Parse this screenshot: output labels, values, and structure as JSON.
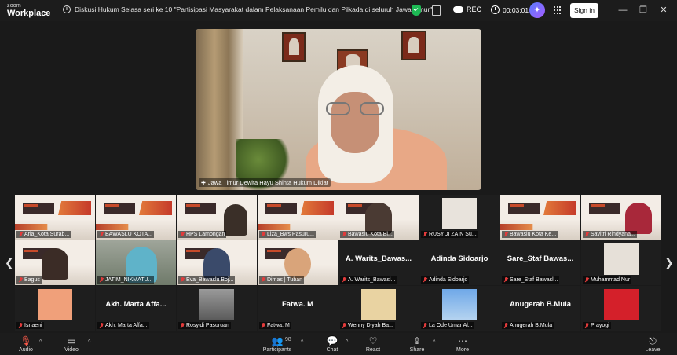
{
  "app": {
    "brand_small": "zoom",
    "brand_big": "Workplace"
  },
  "meeting": {
    "title": "Diskusi Hukum Selasa seri ke 10 \"Partisipasi Masyarakat dalam Pelaksanaan Pemilu dan Pilkada di seluruh Jawa Timur\"",
    "rec_label": "REC",
    "timer": "00:03:01",
    "signin_label": "Sign in"
  },
  "speaker": {
    "label": "Jawa Timur Dewita Hayu Shinta Hukum Diklat"
  },
  "gallery": {
    "row1": [
      "Aria_Kota Surab...",
      "BAWASLU KOTA...",
      "HPS Lamongan",
      "Liza_Bws Pasuru...",
      "Bawaslu Kota Bl...",
      "RUSYDI ZAIN Su...",
      "Bawaslu Kota Ke...",
      "Savitri Rindyana..."
    ],
    "row2": [
      "Bagus",
      "JATIM_NIKMATU...",
      "Eva_Bawaslu Boj...",
      "Dimas | Tuban",
      "A. Warits_Bawasl...",
      "Adinda Sidoarjo",
      "Sare_Staf Bawasl...",
      "Muhammad Nur"
    ],
    "row2_big": {
      "a": "A. Warits_Bawas...",
      "b": "Adinda Sidoarjo",
      "c": "Sare_Staf Bawas..."
    },
    "row3": [
      "Isnaeni",
      "Akh. Marta Affa...",
      "Rosyidi Pasuruan",
      "Fatwa. M",
      "Wenny Diyah Ba...",
      "La Ode Umar Al...",
      "Anugerah B.Mula",
      "Prayogi"
    ],
    "row3_big": {
      "a": "Akh. Marta Affa...",
      "b": "Fatwa. M",
      "c": "Anugerah B.Mula"
    }
  },
  "toolbar": {
    "audio": "Audio",
    "video": "Video",
    "participants": "Participants",
    "participants_count": "98",
    "chat": "Chat",
    "react": "React",
    "share": "Share",
    "more": "More",
    "leave": "Leave"
  },
  "colors": {
    "shield": "#1db954",
    "mute": "#e23b3b",
    "leave": "#ff6a4d"
  }
}
